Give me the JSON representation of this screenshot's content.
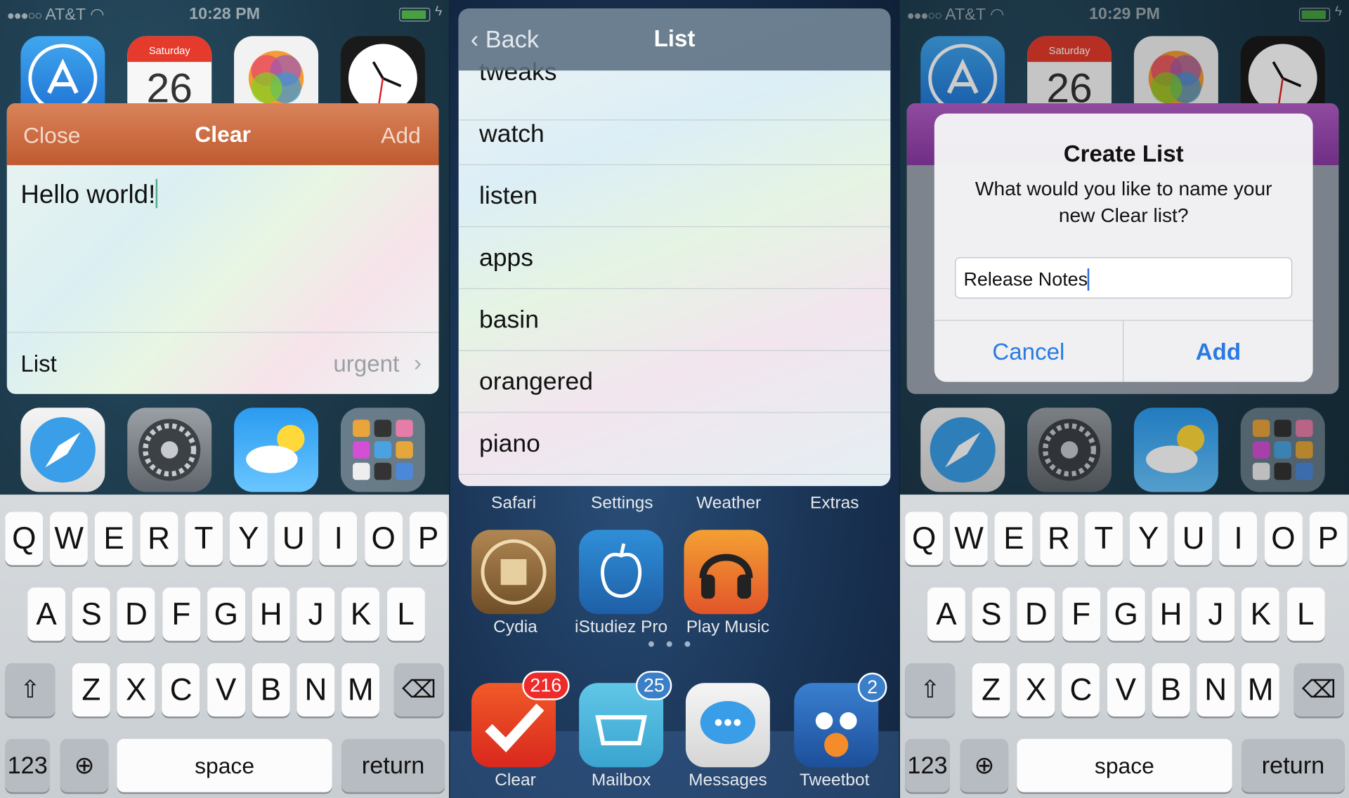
{
  "status1": {
    "carrier": "AT&T",
    "time": "10:28 PM"
  },
  "status3": {
    "carrier": "AT&T",
    "time": "10:29 PM"
  },
  "calendar": {
    "day": "Saturday",
    "date": "26"
  },
  "compose": {
    "close": "Close",
    "title": "Clear",
    "add": "Add",
    "text": "Hello world!",
    "list_label": "List",
    "list_value": "urgent"
  },
  "keyboard": {
    "row1": [
      "Q",
      "W",
      "E",
      "R",
      "T",
      "Y",
      "U",
      "I",
      "O",
      "P"
    ],
    "row2": [
      "A",
      "S",
      "D",
      "F",
      "G",
      "H",
      "J",
      "K",
      "L"
    ],
    "row3": [
      "Z",
      "X",
      "C",
      "V",
      "B",
      "N",
      "M"
    ],
    "numbers": "123",
    "space": "space",
    "return": "return"
  },
  "list_nav": {
    "back": "Back",
    "title": "List"
  },
  "lists": [
    "tweaks",
    "watch",
    "listen",
    "apps",
    "basin",
    "orangered",
    "piano"
  ],
  "home": {
    "dock_labels": [
      "Safari",
      "Settings",
      "Weather",
      "Extras"
    ],
    "apps": [
      {
        "label": "Cydia"
      },
      {
        "label": "iStudiez Pro"
      },
      {
        "label": "Play Music"
      }
    ],
    "dock": [
      {
        "label": "Clear",
        "badge": "216"
      },
      {
        "label": "Mailbox",
        "badge": "25"
      },
      {
        "label": "Messages"
      },
      {
        "label": "Tweetbot",
        "badge": "2"
      }
    ]
  },
  "dialog": {
    "title": "Create List",
    "message": "What would you like to name your new Clear list?",
    "input": "Release Notes",
    "cancel": "Cancel",
    "add": "Add"
  },
  "colors": {
    "clear_bar": "#c9683c",
    "dialog_blue": "#2a7ae2",
    "list_bar_purple": "#9b48b6"
  }
}
